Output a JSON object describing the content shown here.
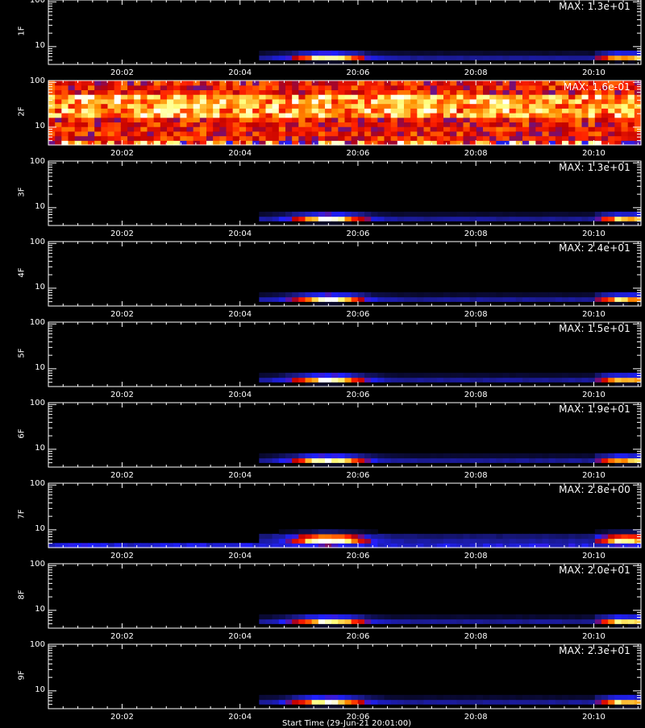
{
  "x_axis": {
    "ticks": [
      "20:02",
      "20:04",
      "20:06",
      "20:08",
      "20:10"
    ],
    "tick_minutes": [
      2,
      4,
      6,
      8,
      10
    ],
    "range_minutes": [
      0.75,
      10.8
    ],
    "title": "Start Time (29-Jun-21 20:01:00)"
  },
  "y_axis": {
    "scale": "log",
    "ticks": [
      "100",
      "10"
    ],
    "tick_values": [
      100,
      10
    ],
    "range": [
      4,
      110
    ]
  },
  "colormap": [
    "#000000",
    "#1a1a8c",
    "#2020ff",
    "#c00000",
    "#ff2000",
    "#ff9000",
    "#ffff80",
    "#ffffff"
  ],
  "chart_data": [
    {
      "type": "heatmap",
      "name": "1F",
      "max_label": "MAX: 1.3e+01",
      "pattern": "bursts"
    },
    {
      "type": "heatmap",
      "name": "2F",
      "max_label": "MAX: 1.6e-01",
      "pattern": "noise"
    },
    {
      "type": "heatmap",
      "name": "3F",
      "max_label": "MAX: 1.3e+01",
      "pattern": "bursts"
    },
    {
      "type": "heatmap",
      "name": "4F",
      "max_label": "MAX: 2.4e+01",
      "pattern": "bursts"
    },
    {
      "type": "heatmap",
      "name": "5F",
      "max_label": "MAX: 1.5e+01",
      "pattern": "bursts"
    },
    {
      "type": "heatmap",
      "name": "6F",
      "max_label": "MAX: 1.9e+01",
      "pattern": "bursts"
    },
    {
      "type": "heatmap",
      "name": "7F",
      "max_label": "MAX: 2.8e+00",
      "pattern": "bursts_wide"
    },
    {
      "type": "heatmap",
      "name": "8F",
      "max_label": "MAX: 2.0e+01",
      "pattern": "bursts"
    },
    {
      "type": "heatmap",
      "name": "9F",
      "max_label": "MAX: 2.3e+01",
      "pattern": "bursts"
    }
  ]
}
